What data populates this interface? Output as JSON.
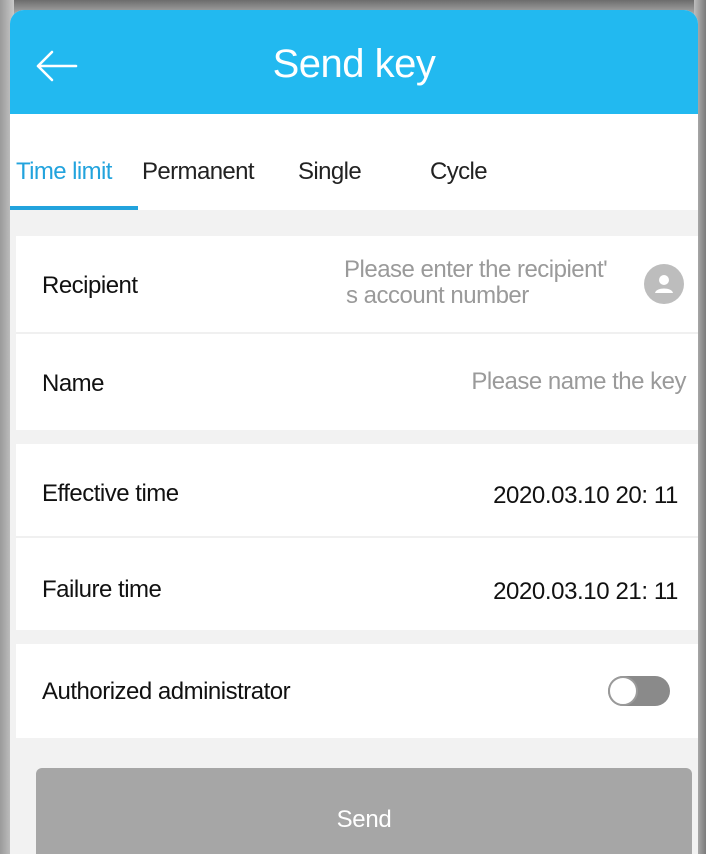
{
  "header": {
    "title": "Send key",
    "back_icon": "arrow-left-icon",
    "color": "#22b9f0"
  },
  "tabs": [
    {
      "label": "Time limit",
      "active": true
    },
    {
      "label": "Permanent",
      "active": false
    },
    {
      "label": "Single",
      "active": false
    },
    {
      "label": "Cycle",
      "active": false
    }
  ],
  "form": {
    "recipient": {
      "label": "Recipient",
      "placeholder_line1": "Please enter the recipient'",
      "placeholder_line2": "s account number",
      "icon": "contact-icon"
    },
    "name": {
      "label": "Name",
      "placeholder": "Please name the key"
    },
    "effective_time": {
      "label": "Effective time",
      "value": "2020.03.10 20: 11"
    },
    "failure_time": {
      "label": "Failure time",
      "value": "2020.03.10 21: 11"
    },
    "authorized_admin": {
      "label": "Authorized administrator",
      "enabled": false
    }
  },
  "send": {
    "label": "Send",
    "color": "#a6a6a6"
  },
  "colors": {
    "accent": "#22a3dd"
  }
}
